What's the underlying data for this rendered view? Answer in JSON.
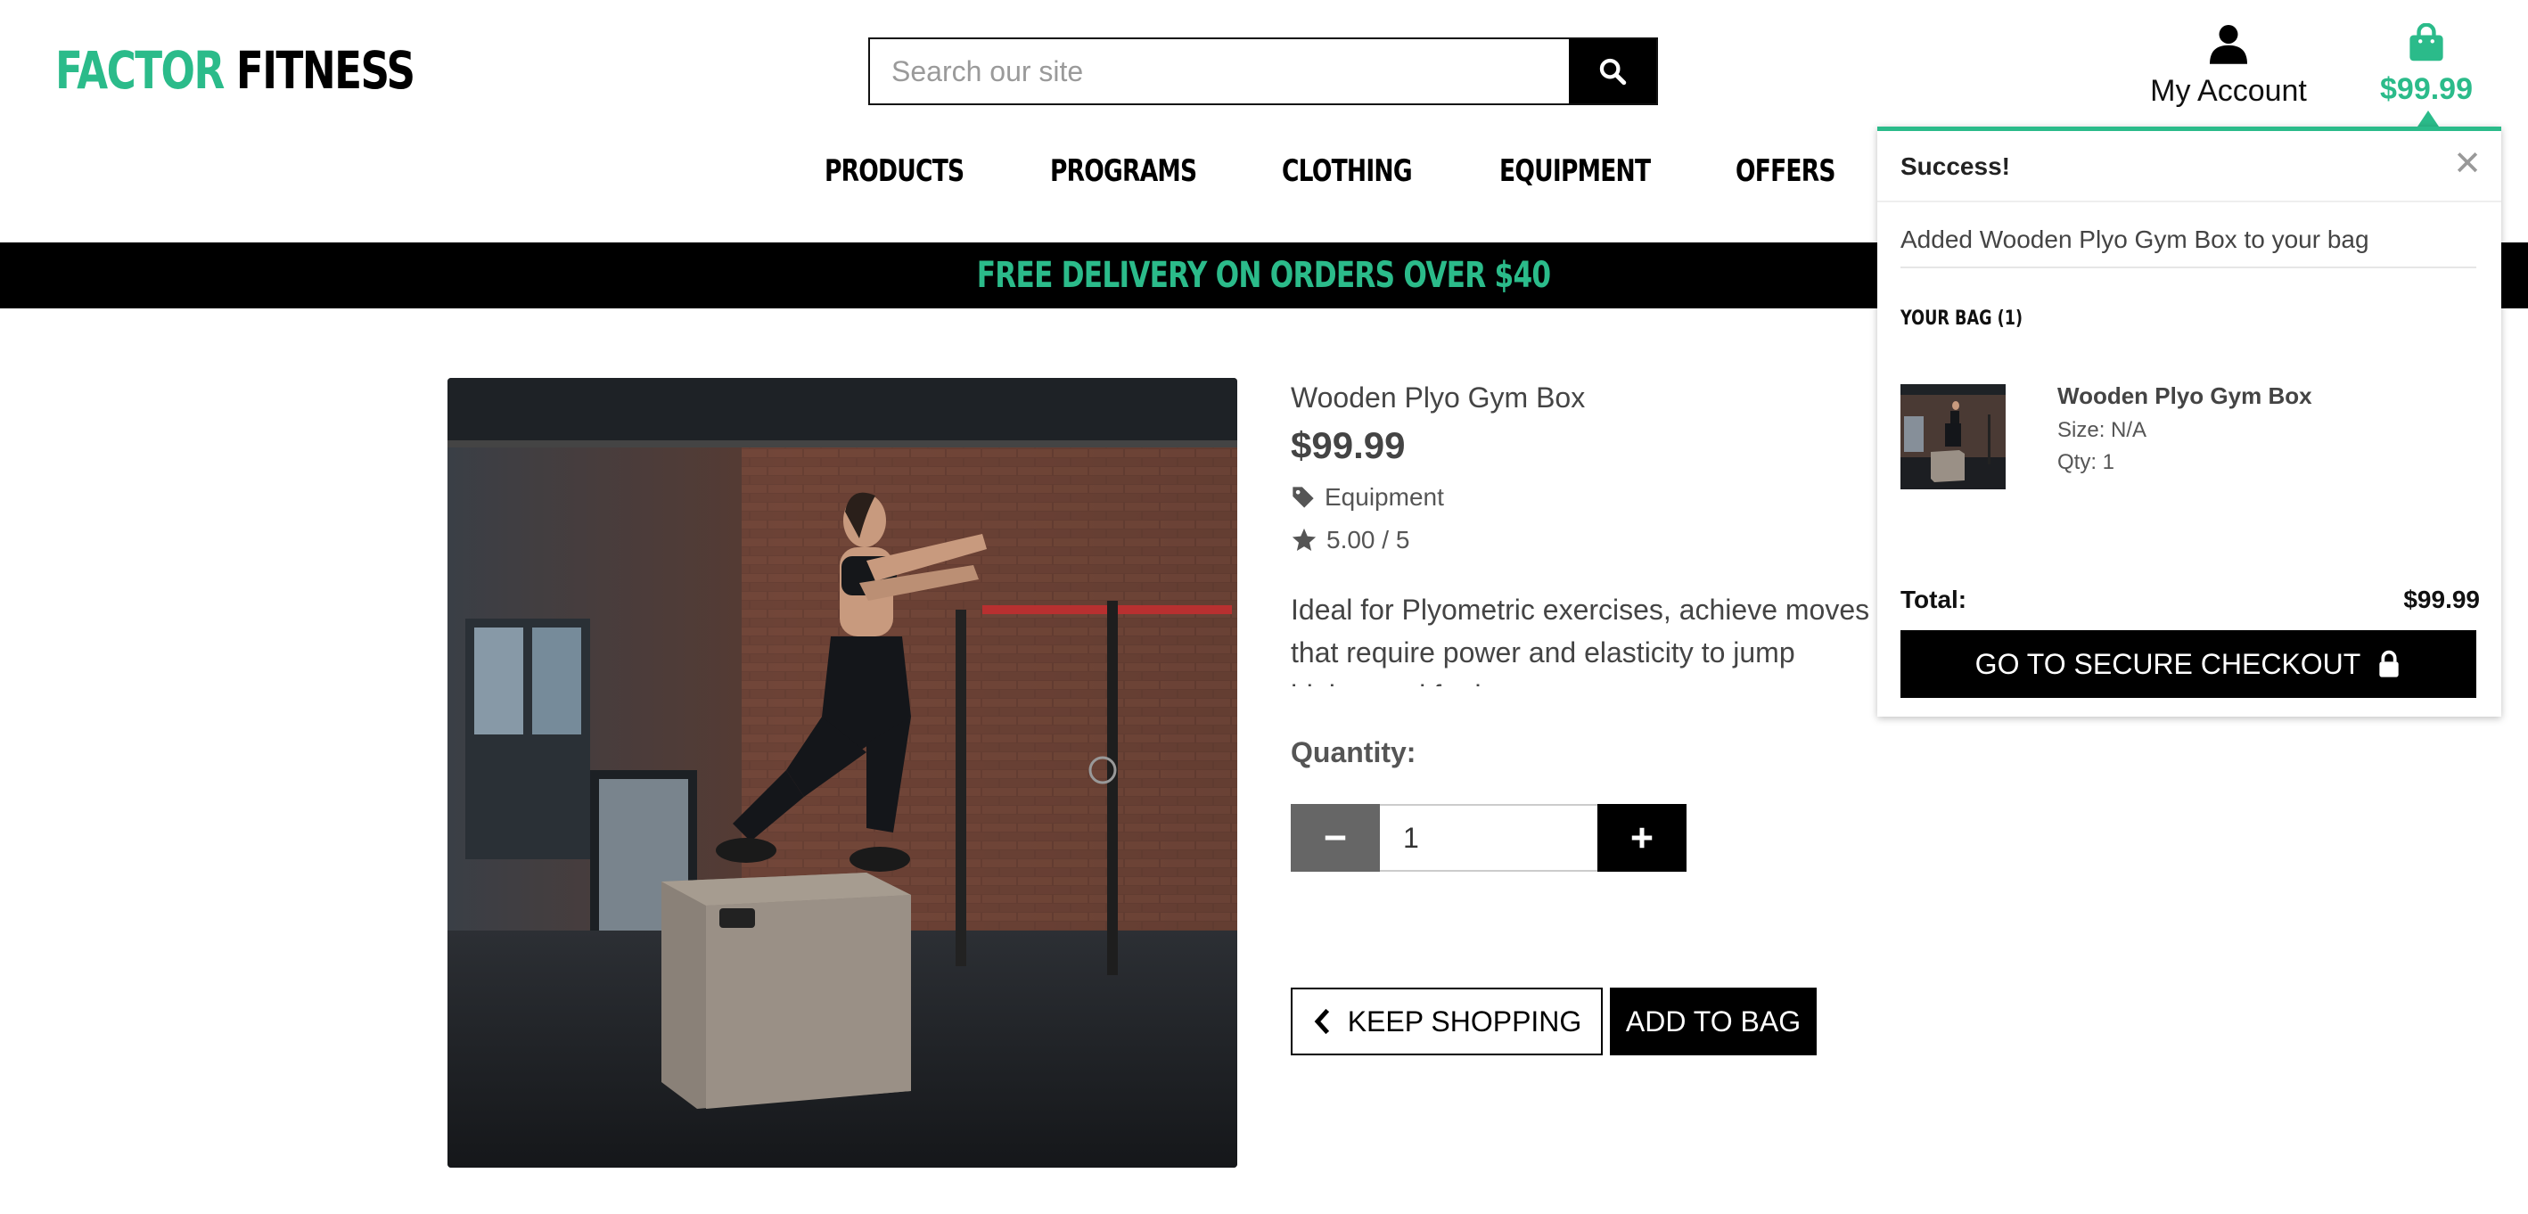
{
  "brand": {
    "part1": "FACTOR",
    "part2": "FITNESS"
  },
  "search": {
    "placeholder": "Search our site",
    "value": ""
  },
  "account": {
    "label": "My Account"
  },
  "bag": {
    "amount": "$99.99"
  },
  "nav": {
    "items": [
      "PRODUCTS",
      "PROGRAMS",
      "CLOTHING",
      "EQUIPMENT",
      "OFFERS"
    ]
  },
  "banner": {
    "text": "FREE DELIVERY ON ORDERS OVER $40"
  },
  "product": {
    "title": "Wooden Plyo Gym Box",
    "price": "$99.99",
    "category": "Equipment",
    "rating": "5.00 / 5",
    "description": "Ideal for Plyometric exercises, achieve moves that require power and elasticity to jump higher and further.",
    "quantity_label": "Quantity:",
    "quantity": "1",
    "keep_shopping_label": "KEEP SHOPPING",
    "add_to_bag_label": "ADD TO BAG"
  },
  "popup": {
    "title": "Success!",
    "close_symbol": "✕",
    "message": "Added Wooden Plyo Gym Box to your bag",
    "bag_heading": "YOUR BAG (1)",
    "item": {
      "name": "Wooden Plyo Gym Box",
      "size": "Size: N/A",
      "qty": "Qty: 1"
    },
    "total_label": "Total:",
    "total_value": "$99.99",
    "checkout_label": "GO TO SECURE CHECKOUT"
  },
  "colors": {
    "accent": "#2bbb8a",
    "dark": "#000000"
  },
  "icons": [
    "search-icon",
    "user-icon",
    "shopping-bag-icon",
    "tag-icon",
    "star-icon",
    "minus-icon",
    "plus-icon",
    "chevron-left-icon",
    "close-icon",
    "lock-icon"
  ]
}
